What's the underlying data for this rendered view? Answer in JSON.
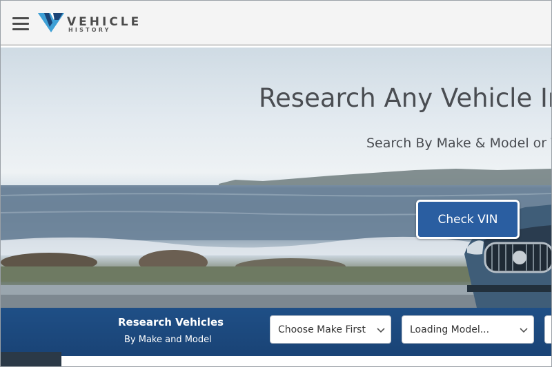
{
  "header": {
    "logo_title": "VEHICLE",
    "logo_subtitle": "HISTORY",
    "menu_icon": "hamburger-menu-icon"
  },
  "hero": {
    "title": "Research Any Vehicle In",
    "subtitle": "Search By Make & Model or V",
    "vin_button_label": "Check VIN"
  },
  "search": {
    "title": "Research Vehicles",
    "subtitle": "By Make and Model",
    "make_select": "Choose Make First",
    "model_select": "Loading Model..."
  },
  "colors": {
    "accent_blue": "#2a5ea1",
    "search_bar_blue": "#1f4f86",
    "header_bg": "#f4f4f4",
    "text_dark": "#4a4d52"
  }
}
